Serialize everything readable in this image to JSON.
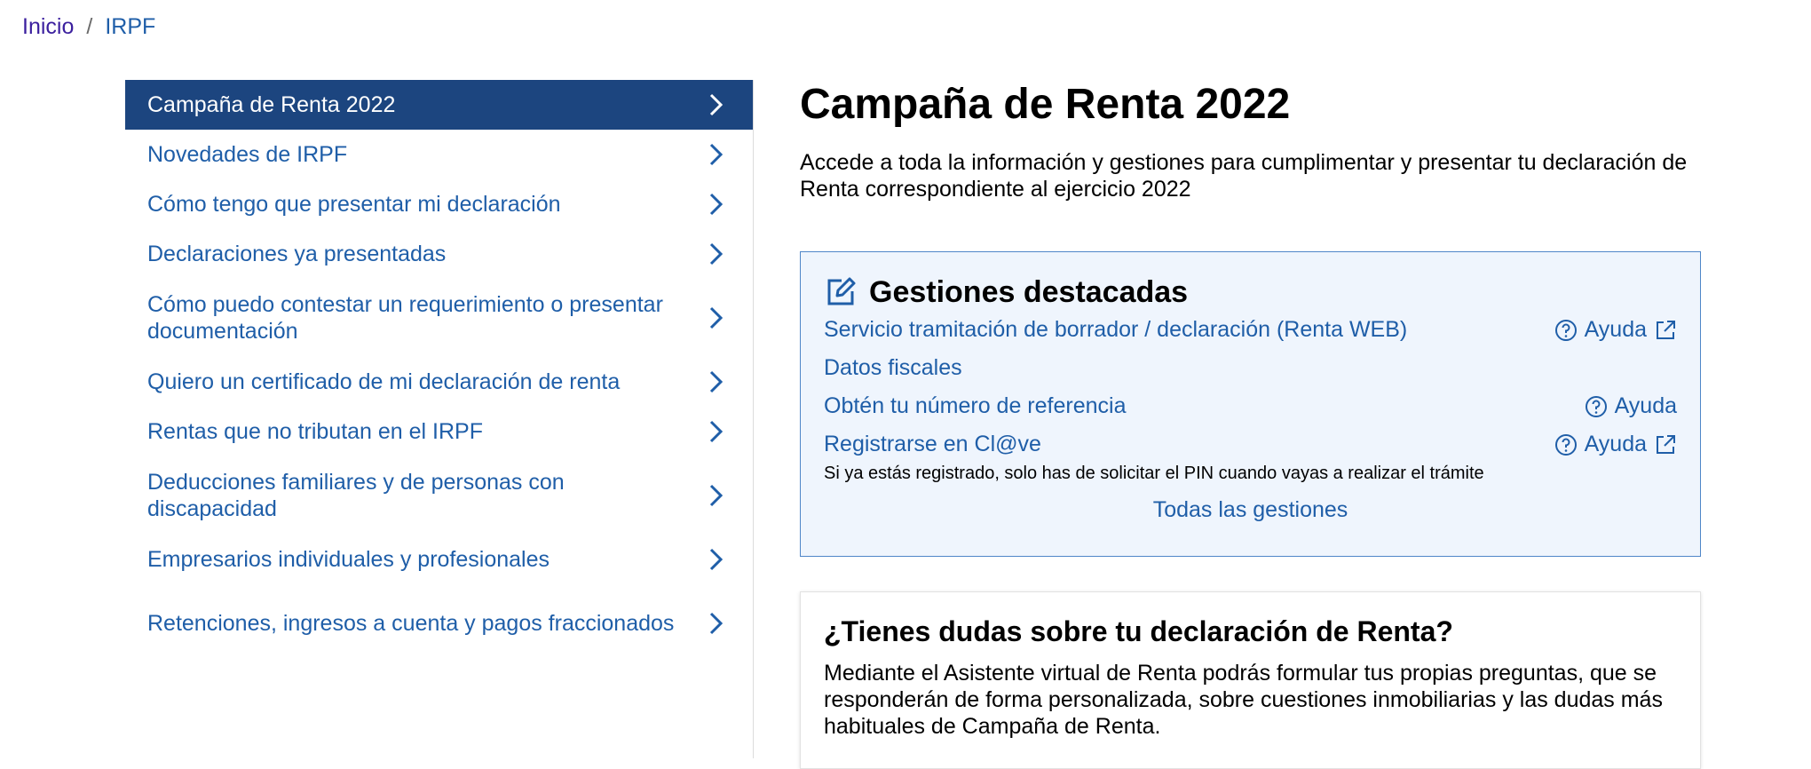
{
  "breadcrumb": {
    "home": "Inicio",
    "separator": "/",
    "current": "IRPF"
  },
  "sidebar": {
    "items": [
      {
        "label": "Campaña de Renta 2022",
        "active": true
      },
      {
        "label": "Novedades de IRPF"
      },
      {
        "label": "Cómo tengo que presentar mi declaración"
      },
      {
        "label": "Declaraciones ya presentadas"
      },
      {
        "label": "Cómo puedo contestar un requerimiento o presentar documentación"
      },
      {
        "label": "Quiero un certificado de mi declaración de renta"
      },
      {
        "label": "Rentas que no tributan en el IRPF"
      },
      {
        "label": "Deducciones familiares y de personas con discapacidad"
      },
      {
        "label": "Empresarios individuales y profesionales"
      },
      {
        "label": "Retenciones, ingresos a cuenta y pagos fraccionados"
      }
    ],
    "chevron_icon": "chevron-right-icon"
  },
  "main": {
    "title": "Campaña de Renta 2022",
    "intro": "Accede a toda la información y gestiones para cumplimentar y presentar tu declaración de Renta correspondiente al ejercicio 2022"
  },
  "gestiones": {
    "icon": "edit-icon",
    "title": "Gestiones destacadas",
    "items": [
      {
        "label": "Servicio tramitación de borrador / declaración (Renta WEB)",
        "help": "Ayuda",
        "help_external": true
      },
      {
        "label": "Datos fiscales",
        "help": ""
      },
      {
        "label": "Obtén tu número de referencia",
        "help": "Ayuda",
        "help_external": false
      },
      {
        "label": "Registrarse en Cl@ve",
        "help": "Ayuda",
        "help_external": true
      }
    ],
    "note": "Si ya estás registrado, solo has de solicitar el PIN cuando vayas a realizar el trámite",
    "all_link": "Todas las gestiones"
  },
  "dudas": {
    "title": "¿Tienes dudas sobre tu declaración de Renta?",
    "text": "Mediante el Asistente virtual de Renta podrás formular tus propias preguntas, que se responderán de forma personalizada, sobre cuestiones inmobiliarias y las dudas más habituales de Campaña de Renta."
  },
  "colors": {
    "link": "#1f5ea8",
    "active_nav_bg": "#1c457f",
    "gestiones_bg": "#eff5fd",
    "gestiones_border": "#4f86c8",
    "home_link": "#3b1f9e"
  }
}
